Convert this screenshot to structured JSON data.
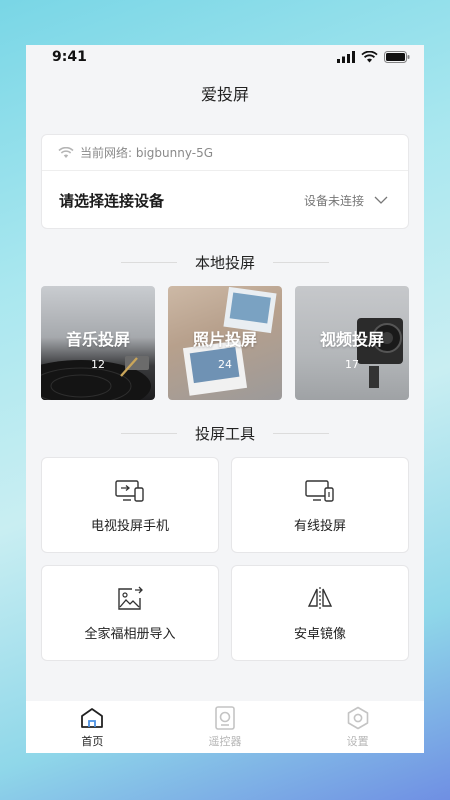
{
  "status_bar": {
    "time": "9:41",
    "icons": [
      "signal-icon",
      "wifi-icon",
      "battery-icon"
    ]
  },
  "nav": {
    "title": "爱投屏"
  },
  "device": {
    "network_label": "当前网络: bigbunny-5G",
    "choose_label": "请选择连接设备",
    "status_label": "设备未连接"
  },
  "local_section": {
    "title": "本地投屏",
    "tiles": [
      {
        "label": "音乐投屏",
        "count": "12"
      },
      {
        "label": "照片投屏",
        "count": "24"
      },
      {
        "label": "视频投屏",
        "count": "17"
      }
    ]
  },
  "tools_section": {
    "title": "投屏工具",
    "tools": [
      {
        "label": "电视投屏手机",
        "icon": "tv-to-phone-icon"
      },
      {
        "label": "有线投屏",
        "icon": "wired-cast-icon"
      },
      {
        "label": "全家福相册导入",
        "icon": "photo-import-icon"
      },
      {
        "label": "安卓镜像",
        "icon": "mirror-icon"
      }
    ]
  },
  "tabbar": {
    "tabs": [
      {
        "label": "首页",
        "icon": "home-icon",
        "active": true
      },
      {
        "label": "遥控器",
        "icon": "remote-icon",
        "active": false
      },
      {
        "label": "设置",
        "icon": "settings-icon",
        "active": false
      }
    ]
  },
  "colors": {
    "background": "#f4f5f7",
    "card": "#ffffff",
    "text_primary": "#222222",
    "text_secondary": "#8a8a8a",
    "tab_inactive": "#b6b6b6"
  }
}
